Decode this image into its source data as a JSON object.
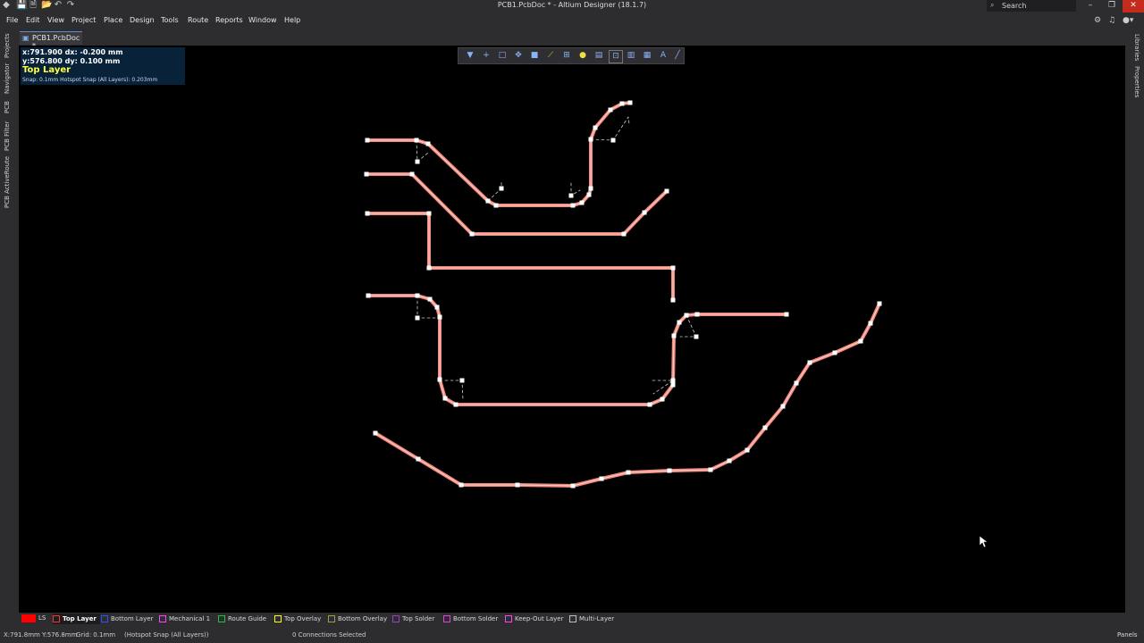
{
  "window": {
    "title": "PCB1.PcbDoc * - Altium Designer (18.1.7)",
    "search_label": "Search",
    "minimize": "–",
    "restore": "❐",
    "close": "✕"
  },
  "quick_access": [
    "💾",
    "🗎",
    "📂",
    "↶",
    "↷"
  ],
  "menu": [
    "File",
    "Edit",
    "View",
    "Project",
    "Place",
    "Design",
    "Tools",
    "Route",
    "Reports",
    "Window",
    "Help"
  ],
  "left_panels": [
    "Projects",
    "Navigator",
    "PCB",
    "PCB Filter",
    "PCB ActiveRoute"
  ],
  "right_panels": [
    "Libraries",
    "Properties"
  ],
  "document_tab": {
    "label": "PCB1.PcbDoc *"
  },
  "hud": {
    "line1": "x:791.900   dx: -0.200 mm",
    "line2": "y:576.800   dy:  0.100 mm",
    "layer": "Top Layer",
    "snap": "Snap: 0.1mm Hotspot Snap (All Layers): 0.203mm"
  },
  "toolbar_icons": [
    "filter-icon",
    "add-icon",
    "select-rect-icon",
    "move-icon",
    "place-fill-icon",
    "route-icon",
    "dimension-icon",
    "pad-icon",
    "via-icon",
    "component-icon",
    "keepout-icon",
    "chart-icon",
    "string-icon",
    "line-icon"
  ],
  "colors": {
    "canvas": "#000000",
    "track": "#f08a80",
    "track_core": "#ffd0c8",
    "vertex": "#ffffff",
    "guide": "#cccccc",
    "hud_bg": "#08223a",
    "layer_yellow": "#ffff40"
  },
  "layers": {
    "ls_label": "LS",
    "tabs": [
      {
        "label": "Top Layer",
        "color": "#ff3030",
        "active": true
      },
      {
        "label": "Bottom Layer",
        "color": "#3050ff",
        "active": false
      },
      {
        "label": "Mechanical 1",
        "color": "#ff40ff",
        "active": false
      },
      {
        "label": "Route Guide",
        "color": "#20c040",
        "active": false
      },
      {
        "label": "Top Overlay",
        "color": "#ffff00",
        "active": false
      },
      {
        "label": "Bottom Overlay",
        "color": "#a0a040",
        "active": false
      },
      {
        "label": "Top Solder",
        "color": "#a040c0",
        "active": false
      },
      {
        "label": "Bottom Solder",
        "color": "#e040e0",
        "active": false
      },
      {
        "label": "Keep-Out Layer",
        "color": "#ff40ff",
        "active": false
      },
      {
        "label": "Multi-Layer",
        "color": "#c0c0c0",
        "active": false
      }
    ]
  },
  "status": {
    "coords": "X:791.8mm Y:576.8mm",
    "grid": "Grid: 0.1mm",
    "snap": "(Hotspot Snap (All Layers))",
    "selection": "0 Connections Selected",
    "panels": "Panels"
  }
}
